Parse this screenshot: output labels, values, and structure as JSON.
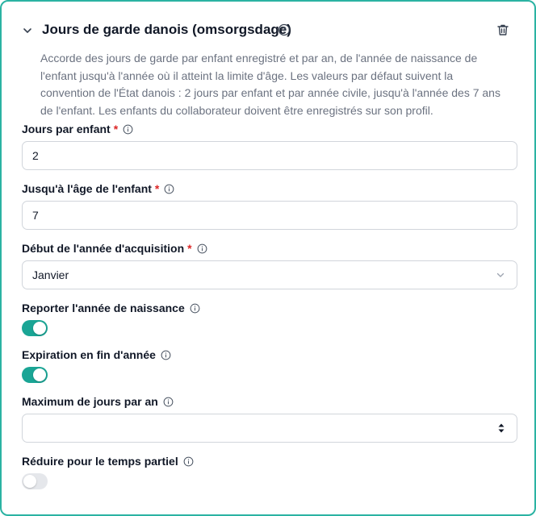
{
  "section": {
    "title": "Jours de garde danois (omsorgsdage)",
    "description": "Accorde des jours de garde par enfant enregistré et par an, de l'année de naissance de l'enfant jusqu'à l'année où il atteint la limite d'âge. Les valeurs par défaut suivent la convention de l'État danois : 2 jours par enfant et par année civile, jusqu'à l'année des 7 ans de l'enfant. Les enfants du collaborateur doivent être enregistrés sur son profil."
  },
  "fields": {
    "days_per_child": {
      "label": "Jours par enfant",
      "required_mark": "*",
      "value": "2"
    },
    "age_limit": {
      "label": "Jusqu'à l'âge de l'enfant",
      "required_mark": "*",
      "value": "7"
    },
    "acquisition_start": {
      "label": "Début de l'année d'acquisition",
      "required_mark": "*",
      "value": "Janvier"
    },
    "carry_birth_year": {
      "label": "Reporter l'année de naissance",
      "enabled": true
    },
    "expire_end_of_year": {
      "label": "Expiration en fin d'année",
      "enabled": true
    },
    "max_days_per_year": {
      "label": "Maximum de jours par an",
      "value": ""
    },
    "reduce_part_time": {
      "label": "Réduire pour le temps partiel",
      "enabled": false
    }
  },
  "colors": {
    "accent": "#1aa595",
    "border_focus": "#2bb3a3",
    "required": "#dc2626",
    "muted_text": "#6b7280"
  },
  "icons": [
    "chevron-down-icon",
    "help-circle-icon",
    "trash-icon",
    "info-icon",
    "select-chevron-icon",
    "spinner-arrows-icon"
  ]
}
